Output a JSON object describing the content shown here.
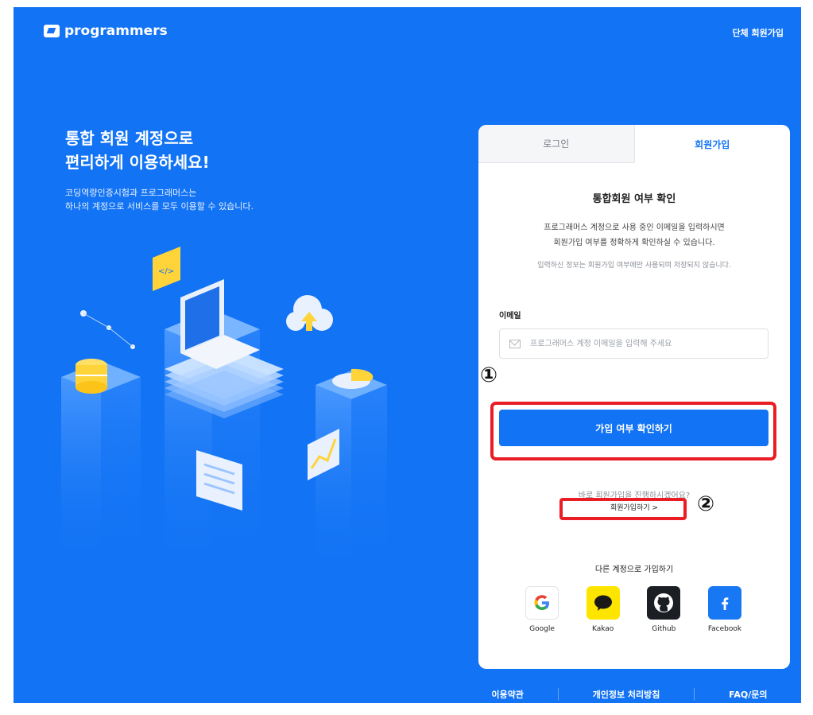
{
  "header": {
    "brand": "programmers",
    "group_signup": "단체 회원가입"
  },
  "hero": {
    "title_line1": "통합 회원 계정으로",
    "title_line2": "편리하게 이용하세요!",
    "desc_line1": "코딩역량인증시험과 프로그래머스는",
    "desc_line2": "하나의 계정으로 서비스를 모두 이용할 수 있습니다."
  },
  "tabs": {
    "login": "로그인",
    "signup": "회원가입"
  },
  "form": {
    "title": "통합회원 여부 확인",
    "desc_line1": "프로그래머스 계정으로 사용 중인 이메일을 입력하시면",
    "desc_line2": "회원가입 여부를 정확하게 확인하실 수 있습니다.",
    "note": "입력하신 정보는 회원가입 여부에만 사용되며 저장되지 않습니다.",
    "email_label": "이메일",
    "email_value": "",
    "email_placeholder": "프로그래머스 계정 이메일을 입력해 주세요",
    "submit": "가입 여부 확인하기",
    "continue_question": "바로 회원가입을 진행하시겠어요?",
    "signup_link": "회원가입하기 >",
    "other_accounts_title": "다른 계정으로 가입하기"
  },
  "socials": [
    {
      "label": "Google",
      "icon": "google-icon",
      "color": "#ffffff"
    },
    {
      "label": "Kakao",
      "icon": "kakao-icon",
      "color": "#fee500"
    },
    {
      "label": "Github",
      "icon": "github-icon",
      "color": "#1b1f23"
    },
    {
      "label": "Facebook",
      "icon": "facebook-icon",
      "color": "#1877f2"
    }
  ],
  "annotations": {
    "marker1": "①",
    "marker2": "②",
    "highlight_color": "#ea1c24"
  },
  "footer": {
    "terms": "이용약관",
    "privacy": "개인정보 처리방침",
    "faq": "FAQ/문의"
  },
  "colors": {
    "brand_blue": "#1273f4"
  }
}
